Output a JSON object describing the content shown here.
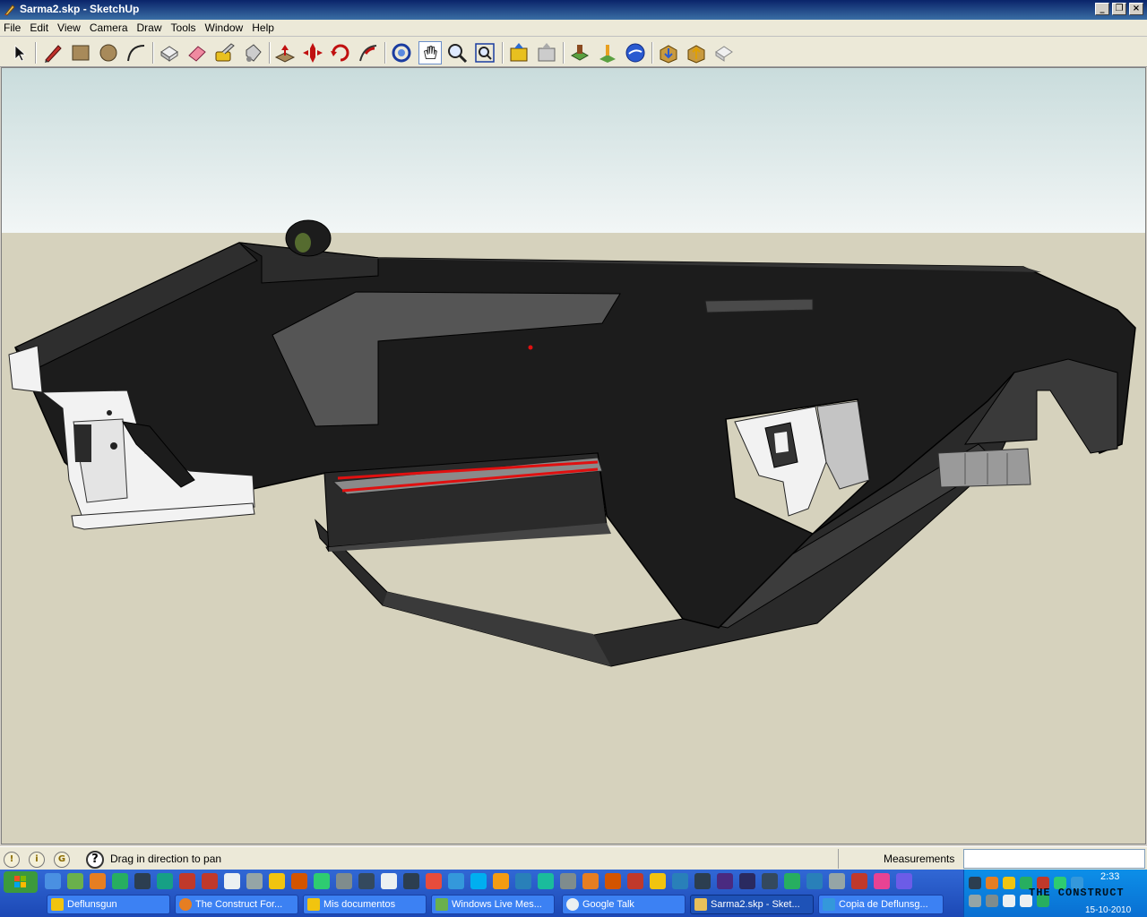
{
  "window": {
    "title": "Sarma2.skp - SketchUp",
    "minimize": "_",
    "maximize": "❐",
    "close": "×"
  },
  "menu": [
    "File",
    "Edit",
    "View",
    "Camera",
    "Draw",
    "Tools",
    "Window",
    "Help"
  ],
  "toolbar": [
    "select-tool-icon",
    "pencil-line-icon",
    "rectangle-icon",
    "circle-icon",
    "arc-icon",
    "make-component-icon",
    "eraser-icon",
    "tape-measure-icon",
    "paint-bucket-icon",
    "push-pull-icon",
    "move-icon",
    "rotate-icon",
    "follow-me-icon",
    "orbit-icon",
    "pan-icon",
    "zoom-icon",
    "zoom-extents-icon",
    "previous-view-icon",
    "next-view-icon",
    "add-location-icon",
    "toggle-terrain-icon",
    "google-earth-icon",
    "get-models-icon",
    "share-model-icon",
    "share-component-icon"
  ],
  "colors": {
    "sky_top": "#c9dcdc",
    "sky_bottom": "#f2f6f6",
    "ground": "#d6d2bd",
    "model_dark": "#1c1c1c",
    "model_mid": "#4a4a4a",
    "model_light": "#f2f2f2",
    "accent_red": "#e01010"
  },
  "status": {
    "hint": "Drag in direction to pan",
    "help": "?",
    "measurements_label": "Measurements",
    "measurements_value": ""
  },
  "taskbar": {
    "tasks": [
      {
        "label": "Deflunsgun",
        "icon": "folder-icon"
      },
      {
        "label": "The Construct For...",
        "icon": "firefox-icon"
      },
      {
        "label": "Mis documentos",
        "icon": "folder-icon"
      },
      {
        "label": "Windows Live Mes...",
        "icon": "messenger-icon"
      },
      {
        "label": "Google Talk",
        "icon": "chat-icon"
      },
      {
        "label": "Sarma2.skp - Sket...",
        "icon": "sketchup-icon",
        "active": true
      },
      {
        "label": "Copia de Deflunsg...",
        "icon": "image-icon"
      }
    ],
    "clock_time": "2:33",
    "clock_date": "15-10-2010",
    "tray_logo": "THE CONSTRUCT"
  }
}
